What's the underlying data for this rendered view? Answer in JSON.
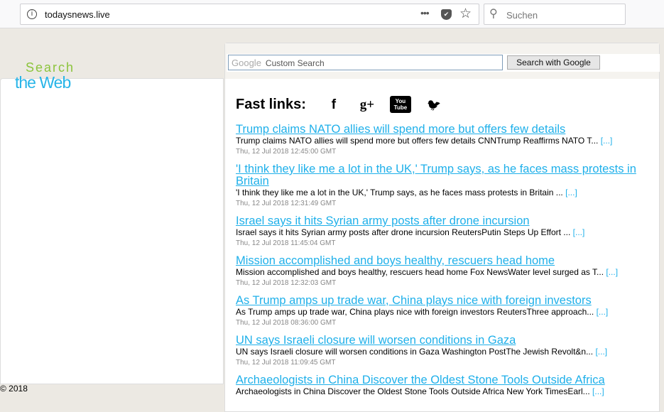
{
  "browser": {
    "url": "todaysnews.live",
    "search_placeholder": "Suchen",
    "info_icon": "i",
    "more_icon": "•••"
  },
  "brand": {
    "line1": "Search",
    "line2": "the Web"
  },
  "footer": {
    "copyright": "© 2018"
  },
  "search": {
    "google_label": "Google",
    "placeholder": "Custom Search",
    "button": "Search with Google"
  },
  "fast_links": {
    "label": "Fast links:",
    "icons": [
      "facebook-icon",
      "google-plus-icon",
      "youtube-icon",
      "twitter-icon"
    ],
    "facebook": "f",
    "gplus": "g+",
    "youtube": "You Tube",
    "twitter": "🐦"
  },
  "colors": {
    "link": "#1fb0ea",
    "brand_green": "#8cc43c",
    "brand_blue": "#28b5e8"
  },
  "news": [
    {
      "title": "Trump claims NATO allies will spend more but offers few details",
      "desc": "Trump claims NATO allies will spend more but offers few details  CNNTrump Reaffirms NATO T...",
      "more": "[...]",
      "time": "Thu, 12 Jul 2018 12:45:00 GMT"
    },
    {
      "title": "'I think they like me a lot in the UK,' Trump says, as he faces mass protests in Britain",
      "desc": "'I think they like me a lot in the UK,' Trump says, as he faces mass protests in Britain  ...",
      "more": "[...]",
      "time": "Thu, 12 Jul 2018 12:31:49 GMT"
    },
    {
      "title": "Israel says it hits Syrian army posts after drone incursion",
      "desc": "Israel says it hits Syrian army posts after drone incursion  ReutersPutin Steps Up Effort ...",
      "more": "[...]",
      "time": "Thu, 12 Jul 2018 11:45:04 GMT"
    },
    {
      "title": "Mission accomplished and boys healthy, rescuers head home",
      "desc": "Mission accomplished and boys healthy, rescuers head home  Fox NewsWater level surged as T...",
      "more": "[...]",
      "time": "Thu, 12 Jul 2018 12:32:03 GMT"
    },
    {
      "title": "As Trump amps up trade war, China plays nice with foreign investors",
      "desc": "As Trump amps up trade war, China plays nice with foreign investors  ReutersThree approach...",
      "more": "[...]",
      "time": "Thu, 12 Jul 2018 08:36:00 GMT"
    },
    {
      "title": "UN says Israeli closure will worsen conditions in Gaza",
      "desc": "UN says Israeli closure will worsen conditions in Gaza  Washington PostThe Jewish Revolt&n...",
      "more": "[...]",
      "time": "Thu, 12 Jul 2018 11:09:45 GMT"
    },
    {
      "title": "Archaeologists in China Discover the Oldest Stone Tools Outside Africa",
      "desc": "Archaeologists in China Discover the Oldest Stone Tools Outside Africa  New York TimesEarl...",
      "more": "[...]",
      "time": ""
    }
  ]
}
